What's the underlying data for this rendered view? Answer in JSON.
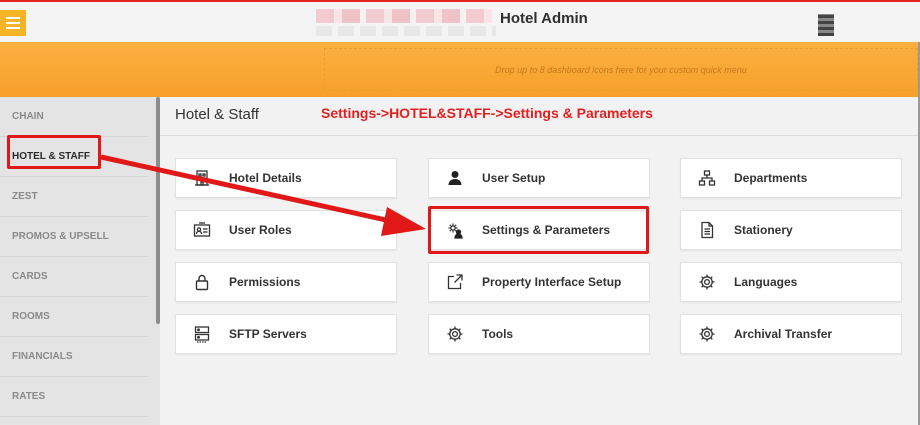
{
  "header": {
    "app_title": "Hotel Admin",
    "menu_icon": "hamburger-icon",
    "user_icon": "user-avatar-icon"
  },
  "quick_menu": {
    "placeholder": "Drop up to 8 dashboard icons here for your custom quick menu"
  },
  "sidebar": {
    "items": [
      {
        "label": "CHAIN"
      },
      {
        "label": "HOTEL & STAFF"
      },
      {
        "label": "ZEST"
      },
      {
        "label": "PROMOS & UPSELL"
      },
      {
        "label": "CARDS"
      },
      {
        "label": "ROOMS"
      },
      {
        "label": "FINANCIALS"
      },
      {
        "label": "RATES"
      }
    ],
    "active_index": 1
  },
  "main": {
    "title": "Hotel & Staff",
    "annotation": "Settings->HOTEL&STAFF->Settings & Parameters",
    "tiles": [
      {
        "label": "Hotel Details",
        "icon": "building-icon"
      },
      {
        "label": "User Setup",
        "icon": "user-icon"
      },
      {
        "label": "Departments",
        "icon": "org-chart-icon"
      },
      {
        "label": "User Roles",
        "icon": "id-card-icon"
      },
      {
        "label": "Settings & Parameters",
        "icon": "user-gear-icon"
      },
      {
        "label": "Stationery",
        "icon": "document-icon"
      },
      {
        "label": "Permissions",
        "icon": "lock-icon"
      },
      {
        "label": "Property Interface Setup",
        "icon": "external-link-icon"
      },
      {
        "label": "Languages",
        "icon": "gear-icon"
      },
      {
        "label": "SFTP Servers",
        "icon": "server-icon"
      },
      {
        "label": "Tools",
        "icon": "gear-icon"
      },
      {
        "label": "Archival Transfer",
        "icon": "gear-icon"
      }
    ]
  },
  "colors": {
    "accent_orange": "#f7a02b",
    "highlight_red": "#e01818"
  }
}
